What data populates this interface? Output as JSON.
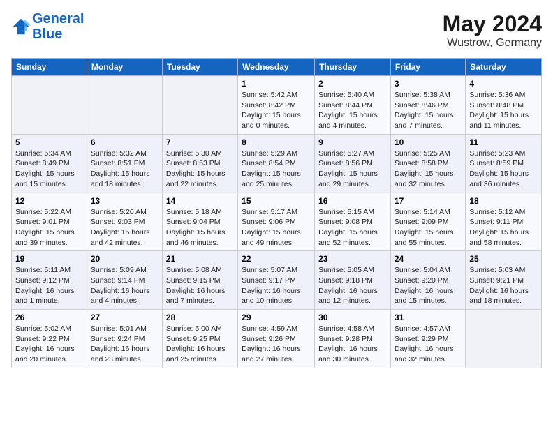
{
  "logo": {
    "line1": "General",
    "line2": "Blue"
  },
  "title": "May 2024",
  "subtitle": "Wustrow, Germany",
  "days_header": [
    "Sunday",
    "Monday",
    "Tuesday",
    "Wednesday",
    "Thursday",
    "Friday",
    "Saturday"
  ],
  "weeks": [
    [
      {
        "num": "",
        "info": ""
      },
      {
        "num": "",
        "info": ""
      },
      {
        "num": "",
        "info": ""
      },
      {
        "num": "1",
        "info": "Sunrise: 5:42 AM\nSunset: 8:42 PM\nDaylight: 15 hours\nand 0 minutes."
      },
      {
        "num": "2",
        "info": "Sunrise: 5:40 AM\nSunset: 8:44 PM\nDaylight: 15 hours\nand 4 minutes."
      },
      {
        "num": "3",
        "info": "Sunrise: 5:38 AM\nSunset: 8:46 PM\nDaylight: 15 hours\nand 7 minutes."
      },
      {
        "num": "4",
        "info": "Sunrise: 5:36 AM\nSunset: 8:48 PM\nDaylight: 15 hours\nand 11 minutes."
      }
    ],
    [
      {
        "num": "5",
        "info": "Sunrise: 5:34 AM\nSunset: 8:49 PM\nDaylight: 15 hours\nand 15 minutes."
      },
      {
        "num": "6",
        "info": "Sunrise: 5:32 AM\nSunset: 8:51 PM\nDaylight: 15 hours\nand 18 minutes."
      },
      {
        "num": "7",
        "info": "Sunrise: 5:30 AM\nSunset: 8:53 PM\nDaylight: 15 hours\nand 22 minutes."
      },
      {
        "num": "8",
        "info": "Sunrise: 5:29 AM\nSunset: 8:54 PM\nDaylight: 15 hours\nand 25 minutes."
      },
      {
        "num": "9",
        "info": "Sunrise: 5:27 AM\nSunset: 8:56 PM\nDaylight: 15 hours\nand 29 minutes."
      },
      {
        "num": "10",
        "info": "Sunrise: 5:25 AM\nSunset: 8:58 PM\nDaylight: 15 hours\nand 32 minutes."
      },
      {
        "num": "11",
        "info": "Sunrise: 5:23 AM\nSunset: 8:59 PM\nDaylight: 15 hours\nand 36 minutes."
      }
    ],
    [
      {
        "num": "12",
        "info": "Sunrise: 5:22 AM\nSunset: 9:01 PM\nDaylight: 15 hours\nand 39 minutes."
      },
      {
        "num": "13",
        "info": "Sunrise: 5:20 AM\nSunset: 9:03 PM\nDaylight: 15 hours\nand 42 minutes."
      },
      {
        "num": "14",
        "info": "Sunrise: 5:18 AM\nSunset: 9:04 PM\nDaylight: 15 hours\nand 46 minutes."
      },
      {
        "num": "15",
        "info": "Sunrise: 5:17 AM\nSunset: 9:06 PM\nDaylight: 15 hours\nand 49 minutes."
      },
      {
        "num": "16",
        "info": "Sunrise: 5:15 AM\nSunset: 9:08 PM\nDaylight: 15 hours\nand 52 minutes."
      },
      {
        "num": "17",
        "info": "Sunrise: 5:14 AM\nSunset: 9:09 PM\nDaylight: 15 hours\nand 55 minutes."
      },
      {
        "num": "18",
        "info": "Sunrise: 5:12 AM\nSunset: 9:11 PM\nDaylight: 15 hours\nand 58 minutes."
      }
    ],
    [
      {
        "num": "19",
        "info": "Sunrise: 5:11 AM\nSunset: 9:12 PM\nDaylight: 16 hours\nand 1 minute."
      },
      {
        "num": "20",
        "info": "Sunrise: 5:09 AM\nSunset: 9:14 PM\nDaylight: 16 hours\nand 4 minutes."
      },
      {
        "num": "21",
        "info": "Sunrise: 5:08 AM\nSunset: 9:15 PM\nDaylight: 16 hours\nand 7 minutes."
      },
      {
        "num": "22",
        "info": "Sunrise: 5:07 AM\nSunset: 9:17 PM\nDaylight: 16 hours\nand 10 minutes."
      },
      {
        "num": "23",
        "info": "Sunrise: 5:05 AM\nSunset: 9:18 PM\nDaylight: 16 hours\nand 12 minutes."
      },
      {
        "num": "24",
        "info": "Sunrise: 5:04 AM\nSunset: 9:20 PM\nDaylight: 16 hours\nand 15 minutes."
      },
      {
        "num": "25",
        "info": "Sunrise: 5:03 AM\nSunset: 9:21 PM\nDaylight: 16 hours\nand 18 minutes."
      }
    ],
    [
      {
        "num": "26",
        "info": "Sunrise: 5:02 AM\nSunset: 9:22 PM\nDaylight: 16 hours\nand 20 minutes."
      },
      {
        "num": "27",
        "info": "Sunrise: 5:01 AM\nSunset: 9:24 PM\nDaylight: 16 hours\nand 23 minutes."
      },
      {
        "num": "28",
        "info": "Sunrise: 5:00 AM\nSunset: 9:25 PM\nDaylight: 16 hours\nand 25 minutes."
      },
      {
        "num": "29",
        "info": "Sunrise: 4:59 AM\nSunset: 9:26 PM\nDaylight: 16 hours\nand 27 minutes."
      },
      {
        "num": "30",
        "info": "Sunrise: 4:58 AM\nSunset: 9:28 PM\nDaylight: 16 hours\nand 30 minutes."
      },
      {
        "num": "31",
        "info": "Sunrise: 4:57 AM\nSunset: 9:29 PM\nDaylight: 16 hours\nand 32 minutes."
      },
      {
        "num": "",
        "info": ""
      }
    ]
  ]
}
